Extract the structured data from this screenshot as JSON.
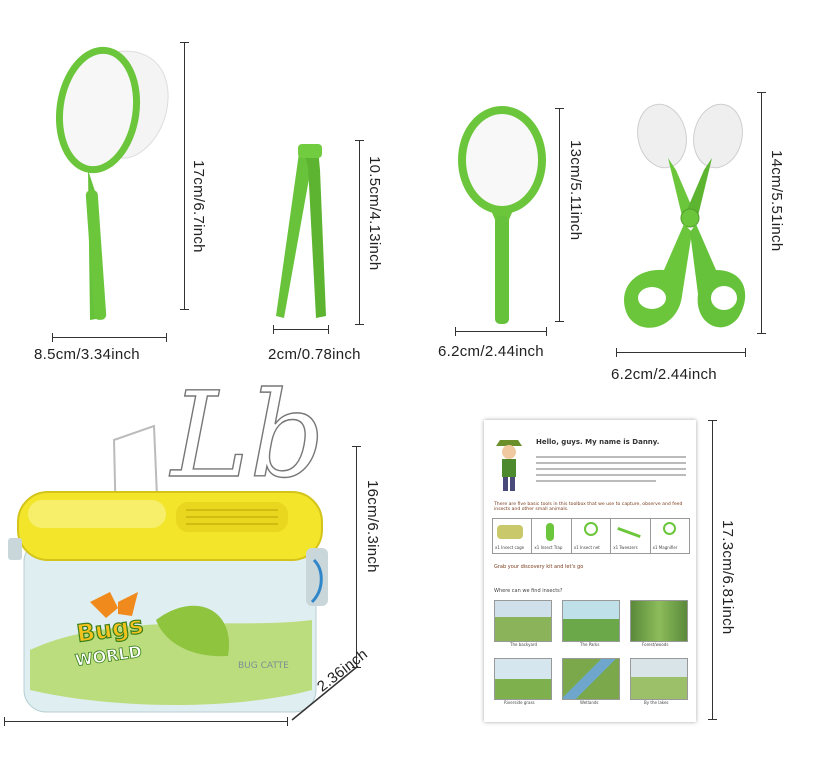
{
  "dimensions": {
    "net_width": "8.5cm/3.34inch",
    "net_height": "17cm/6.7inch",
    "tweezers_width": "2cm/0.78inch",
    "tweezers_height": "10.5cm/4.13inch",
    "magnifier_width": "6.2cm/2.44inch",
    "magnifier_height": "13cm/5.11inch",
    "scissors_width": "6.2cm/2.44inch",
    "scissors_height": "14cm/5.51inch",
    "box_height": "16cm/6.3inch",
    "box_depth": "2.36inch",
    "guide_height": "17.3cm/6.81inch"
  },
  "watermark": "Lb",
  "box_labels": {
    "brand_top": "Bugs",
    "brand_bottom": "WORLD",
    "side_text": "BUG CATTE"
  },
  "guide": {
    "heading": "Hello, guys. My name is Danny.",
    "tools_intro": "There are five basic tools in this toolbox that we use to capture, observe and feed insects and other small animals.",
    "tool_labels": [
      "x1 Insect cage",
      "x1 Insect Trap",
      "x1 Insect net",
      "x1 Tweezers",
      "x1 Magnifier"
    ],
    "prompt": "Grab your discovery kit and let's go",
    "where": "Where can we find insects?",
    "scene_labels": [
      "The backyard",
      "The Parks",
      "Forest/woods",
      "Riverside grass",
      "Wetlands",
      "By the lakes"
    ]
  },
  "colors": {
    "tool_green": "#6cc63c",
    "lid_yellow": "#f2e52a"
  }
}
